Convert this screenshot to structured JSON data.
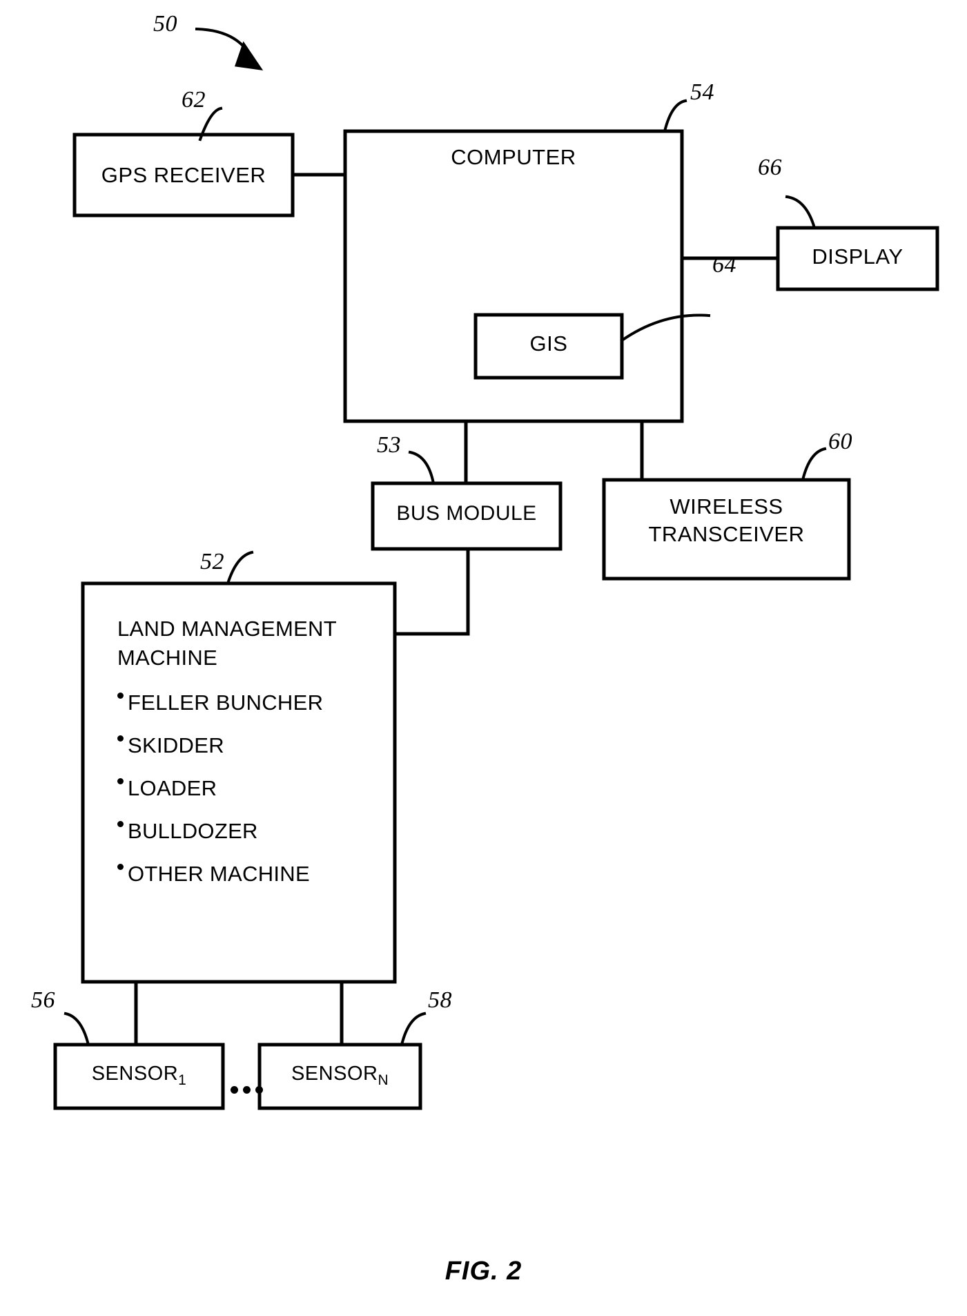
{
  "figure": {
    "caption": "FIG. 2",
    "system_ref": "50"
  },
  "nodes": {
    "gps_receiver": {
      "label": "GPS RECEIVER",
      "ref": "62"
    },
    "computer": {
      "label": "COMPUTER",
      "ref": "54"
    },
    "gis": {
      "label": "GIS",
      "ref": "64"
    },
    "display": {
      "label": "DISPLAY",
      "ref": "66"
    },
    "bus_module": {
      "label": "BUS MODULE",
      "ref": "53"
    },
    "wireless_transceiver": {
      "label": "WIRELESS\nTRANSCEIVER",
      "ref": "60"
    },
    "land_management_machine": {
      "title": "LAND MANAGEMENT\nMACHINE",
      "ref": "52",
      "items": [
        "FELLER BUNCHER",
        "SKIDDER",
        "LOADER",
        "BULLDOZER",
        "OTHER MACHINE"
      ]
    },
    "sensor_first": {
      "label": "SENSOR",
      "subscript": "1",
      "ref": "56"
    },
    "sensor_last": {
      "label": "SENSOR",
      "subscript": "N",
      "ref": "58"
    },
    "sensor_ellipsis": "•••"
  },
  "colors": {
    "line": "#000000",
    "background": "#ffffff",
    "text": "#000000"
  }
}
